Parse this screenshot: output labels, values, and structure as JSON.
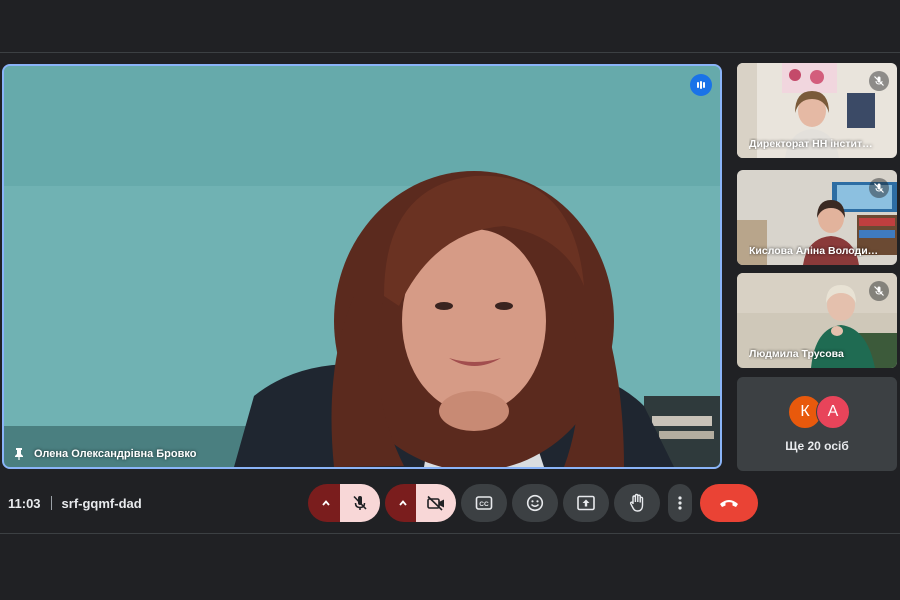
{
  "main_speaker": {
    "name": "Олена Олександрівна Бровко",
    "pin_icon": "pin-icon",
    "speaking_icon": "speaking-indicator-icon",
    "highlight_color": "#8ab4f8"
  },
  "participants": [
    {
      "name": "Директорат НН інстит…",
      "muted": true
    },
    {
      "name": "Кислова Аліна Володи…",
      "muted": true
    },
    {
      "name": "Людмила Трусова",
      "muted": true
    }
  ],
  "others": {
    "avatars": [
      {
        "letter": "К",
        "color": "#e8590c"
      },
      {
        "letter": "А",
        "color": "#e8445a"
      }
    ],
    "label": "Ще 20 осіб"
  },
  "meeting": {
    "time": "11:03",
    "code": "srf-gqmf-dad"
  },
  "controls": {
    "mic": {
      "state": "off",
      "icon": "mic-off-icon",
      "options_icon": "chevron-up-icon"
    },
    "camera": {
      "state": "off",
      "icon": "camera-off-icon",
      "options_icon": "chevron-up-icon"
    },
    "captions_icon": "closed-captions-icon",
    "emoji_icon": "emoji-icon",
    "present_icon": "present-screen-icon",
    "raise_hand_icon": "raise-hand-icon",
    "more_icon": "more-options-icon",
    "leave_icon": "leave-call-icon",
    "leave_color": "#ea4335"
  }
}
